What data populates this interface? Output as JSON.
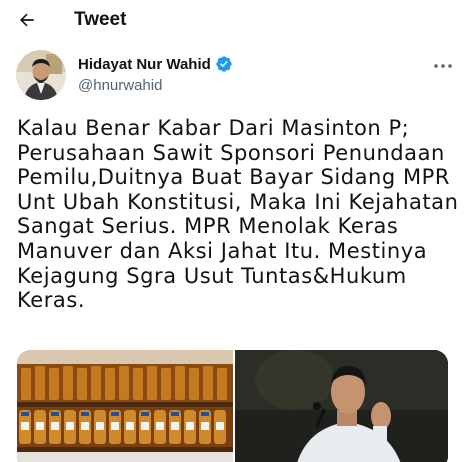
{
  "header": {
    "title": "Tweet",
    "back_icon": "arrow-left-icon"
  },
  "author": {
    "display_name": "Hidayat Nur Wahid",
    "handle": "@hnurwahid",
    "verified": true,
    "verified_color": "#1d9bf0",
    "more_icon": "more-horizontal-icon"
  },
  "tweet": {
    "lines": [
      "Kalau Benar Kabar Dari Masinton P;",
      "Perusahaan Sawit Sponsori Penundaan",
      "Pemilu,Duitnya Buat Bayar Sidang MPR",
      "Unt Ubah Konstitusi, Maka Ini Kejahatan",
      "Sangat Serius. MPR Menolak Keras",
      "Manuver dan Aksi Jahat Itu. Mestinya",
      "Kejagung Sgra Usut Tuntas&Hukum",
      "Keras."
    ]
  },
  "media": {
    "count": 2
  },
  "colors": {
    "text_primary": "#0f1419",
    "text_secondary": "#536471",
    "accent": "#1d9bf0"
  }
}
